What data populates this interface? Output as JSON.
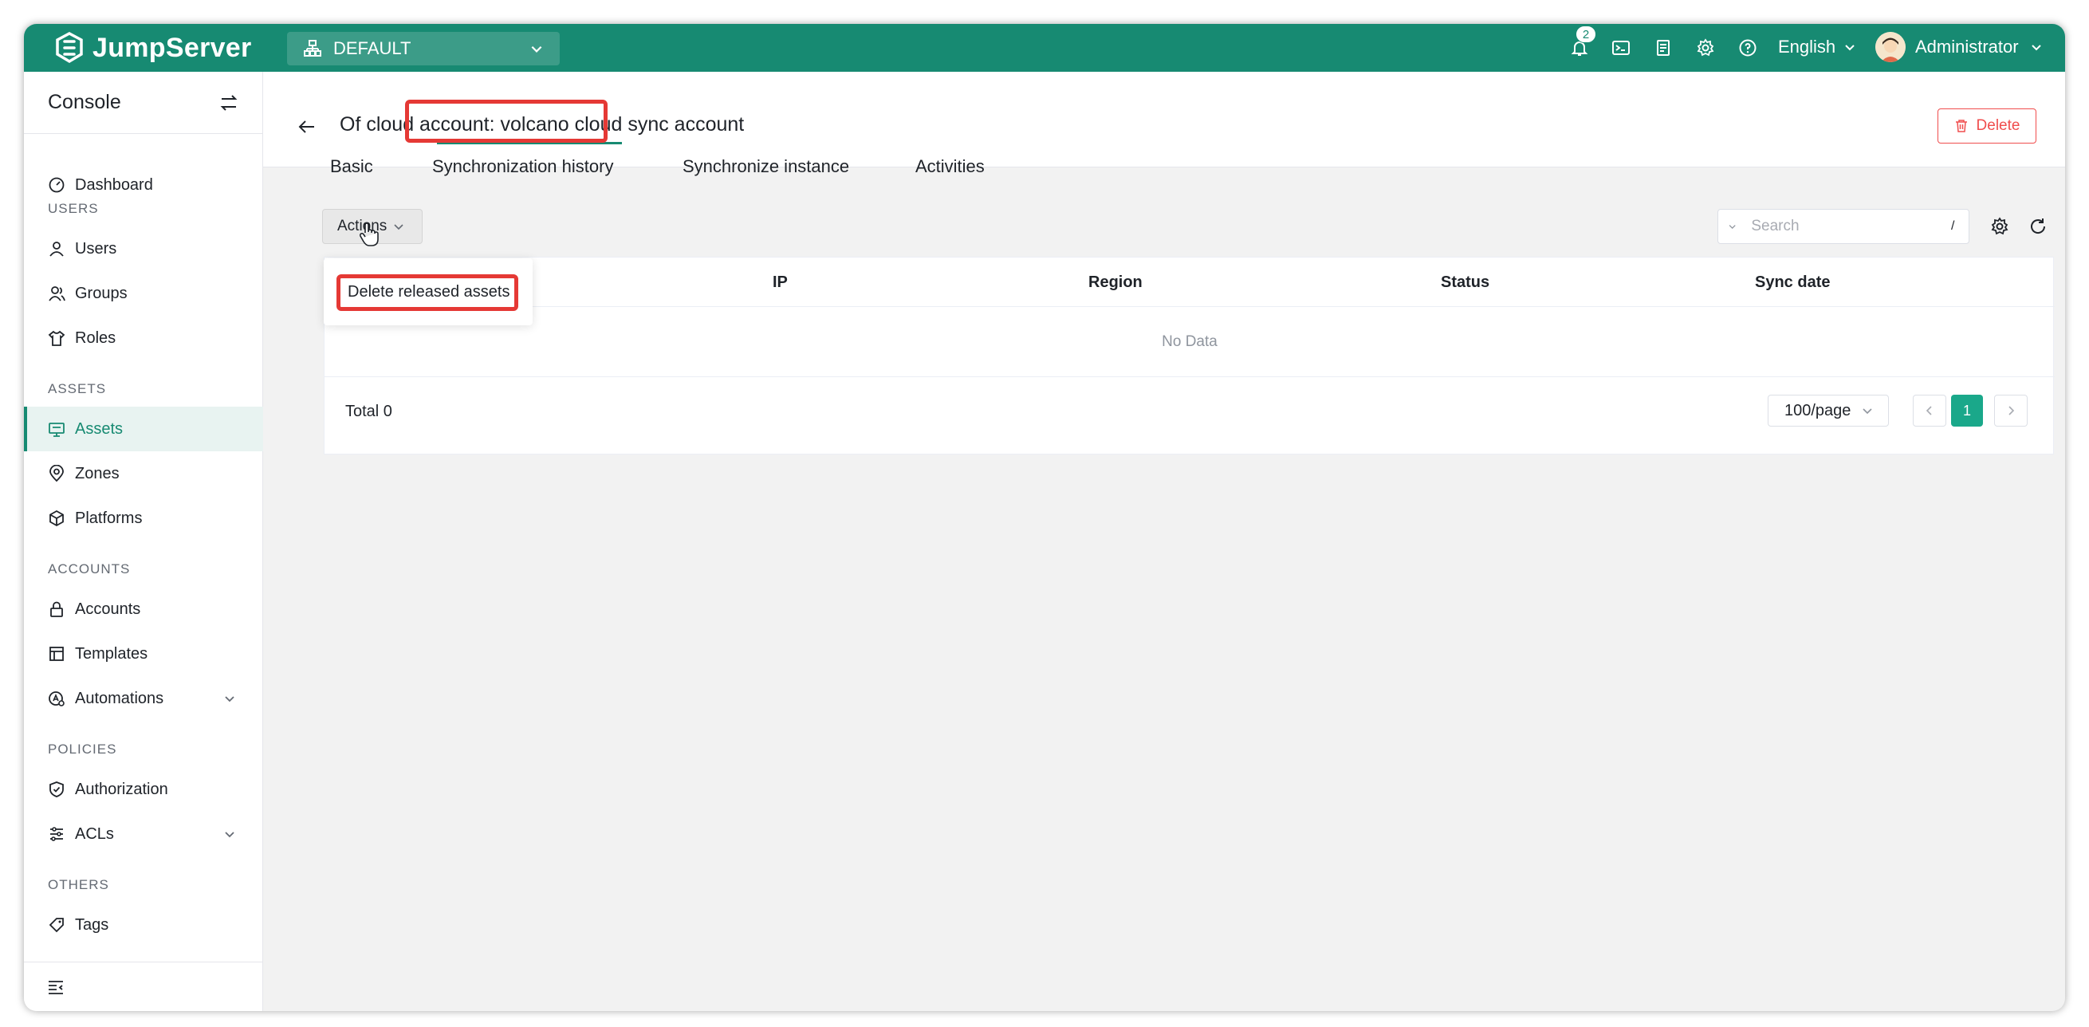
{
  "brand": {
    "name": "JumpServer"
  },
  "org_selector": {
    "value": "DEFAULT"
  },
  "topbar": {
    "notification_count": "2",
    "language": "English",
    "user_name": "Administrator",
    "icons": [
      "bell-icon",
      "terminal-icon",
      "clipboard-icon",
      "gear-icon",
      "help-icon"
    ]
  },
  "sidebar": {
    "title": "Console",
    "sections": {
      "users": "USERS",
      "assets": "ASSETS",
      "accounts": "ACCOUNTS",
      "policies": "POLICIES",
      "others": "OTHERS"
    },
    "items": {
      "dashboard": "Dashboard",
      "users": "Users",
      "groups": "Groups",
      "roles": "Roles",
      "assets": "Assets",
      "zones": "Zones",
      "platforms": "Platforms",
      "accounts": "Accounts",
      "templates": "Templates",
      "automations": "Automations",
      "authorization": "Authorization",
      "acls": "ACLs",
      "tags": "Tags"
    },
    "active_item": "Assets"
  },
  "page": {
    "title": "Of cloud account: volcano cloud sync account",
    "delete_label": "Delete",
    "tabs": [
      "Basic",
      "Synchronization history",
      "Synchronize instance",
      "Activities"
    ],
    "active_tab": "Synchronize instance"
  },
  "toolbar": {
    "actions_label": "Actions",
    "search_placeholder": "Search",
    "search_shortcut": "/"
  },
  "actions_menu": {
    "items": [
      "Delete released assets"
    ]
  },
  "table": {
    "columns": [
      "IP",
      "Region",
      "Status",
      "Sync date"
    ],
    "empty_text": "No Data",
    "total": "Total 0",
    "page_size": "100/page",
    "current_page": "1"
  },
  "colors": {
    "brand": "#178a72",
    "danger": "#f04d4d",
    "highlight": "#e53935"
  }
}
